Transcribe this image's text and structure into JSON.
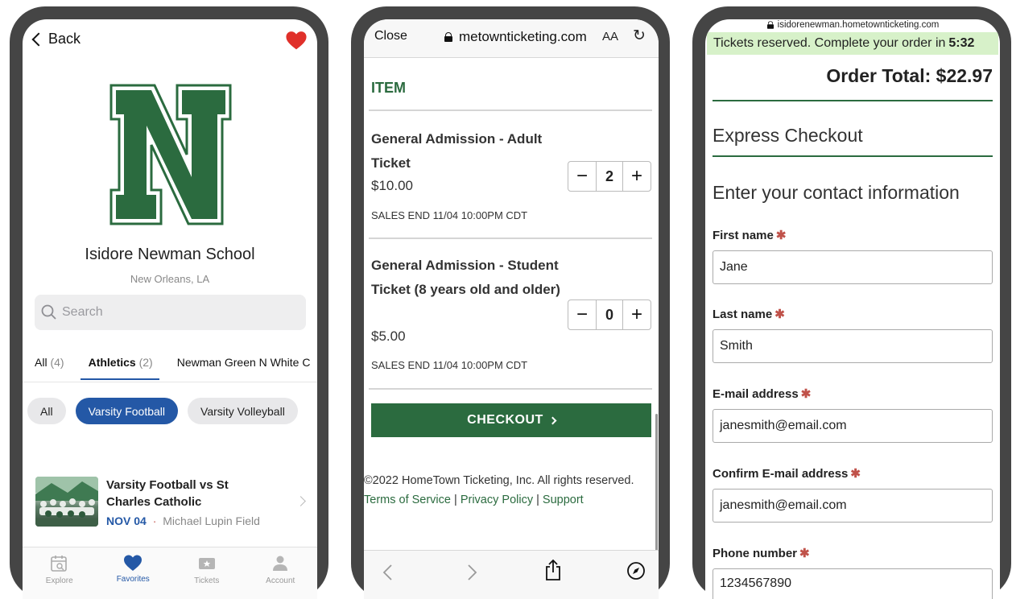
{
  "phone1": {
    "back_label": "Back",
    "school_name": "Isidore Newman School",
    "location": "New Orleans, LA",
    "search_placeholder": "Search",
    "tabs": [
      {
        "label": "All",
        "count": "(4)"
      },
      {
        "label": "Athletics",
        "count": "(2)"
      },
      {
        "label": "Newman Green N White C",
        "count": ""
      }
    ],
    "chips": [
      "All",
      "Varsity Football",
      "Varsity Volleyball"
    ],
    "event": {
      "title": "Varsity Football vs St Charles Catholic",
      "date": "NOV 04",
      "separator": "·",
      "venue": "Michael Lupin Field"
    },
    "nav": [
      "Explore",
      "Favorites",
      "Tickets",
      "Account"
    ],
    "colors": {
      "accent": "#2458a6",
      "heart": "#e0302a",
      "logo_green": "#2b6b3f"
    }
  },
  "phone2": {
    "close_label": "Close",
    "url": "metownticketing.com",
    "text_size_label": "AA",
    "reload_icon": "↻",
    "item_header": "ITEM",
    "tickets": [
      {
        "title": "General Admission - Adult Ticket",
        "price": "$10.00",
        "sales_end": "SALES END 11/04 10:00PM CDT",
        "qty": "2"
      },
      {
        "title": "General Admission - Student Ticket (8 years old and older)",
        "price": "$5.00",
        "sales_end": "SALES END 11/04 10:00PM CDT",
        "qty": "0"
      }
    ],
    "checkout_label": "CHECKOUT",
    "copyright": "©2022 HomeTown Ticketing, Inc. All rights reserved.",
    "links": [
      "Terms of Service",
      "Privacy Policy",
      "Support"
    ],
    "link_sep": "|"
  },
  "phone3": {
    "url": "isidorenewman.hometownticketing.com",
    "reserved_text": "Tickets reserved. Complete your order in",
    "reserved_timer": "5:32",
    "order_total": "Order Total: $22.97",
    "express_heading": "Express Checkout",
    "contact_heading": "Enter your contact information",
    "required_mark": "✱",
    "fields": [
      {
        "label": "First name",
        "value": "Jane"
      },
      {
        "label": "Last name",
        "value": "Smith"
      },
      {
        "label": "E-mail address",
        "value": "janesmith@email.com"
      },
      {
        "label": "Confirm E-mail address",
        "value": "janesmith@email.com"
      },
      {
        "label": "Phone number",
        "value": "1234567890"
      }
    ],
    "colors": {
      "banner": "#d7f1c9",
      "green": "#2b6b3f",
      "required": "#c0524a"
    }
  }
}
